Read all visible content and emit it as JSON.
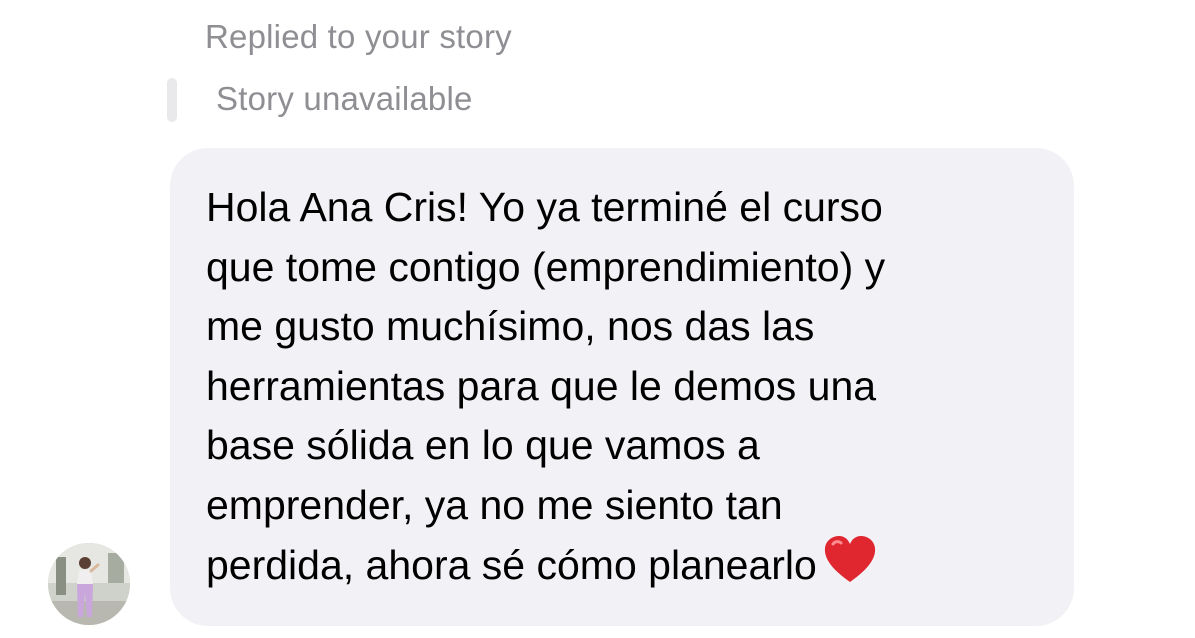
{
  "reply_context": {
    "label": "Replied to your story",
    "story_status": "Story unavailable"
  },
  "message": {
    "text": "Hola Ana Cris! Yo ya terminé el curso\nque tome contigo (emprendimiento) y\nme gusto muchísimo, nos das las\nherramientas para que le demos una\nbase sólida en lo que vamos a\nemprender, ya no me siento tan\nperdida, ahora sé cómo planearlo",
    "emoji": "red-heart-icon",
    "bubble_color": "#f2f2f6"
  },
  "sender": {
    "avatar": "avatar-photo"
  },
  "colors": {
    "muted_text": "#8e8e93",
    "heart": "#e0262f"
  }
}
